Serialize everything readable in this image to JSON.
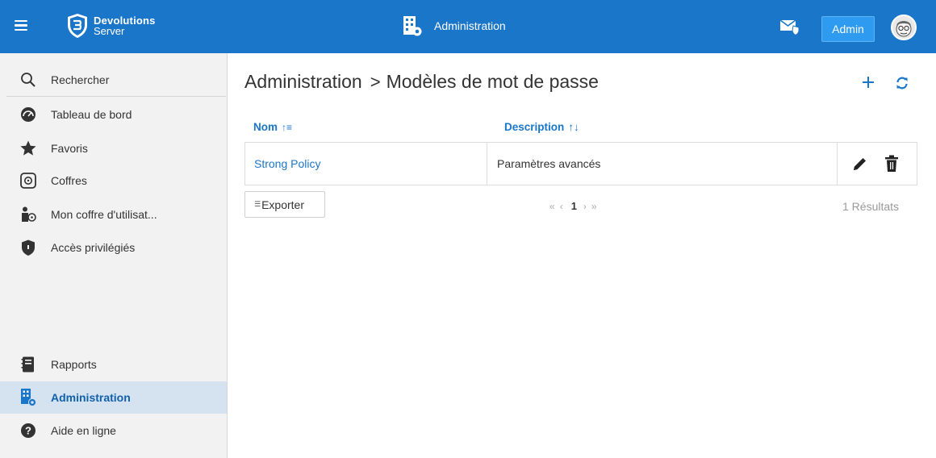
{
  "topbar": {
    "logo": {
      "line1": "Devolutions",
      "line2": "Server"
    },
    "section_title": "Administration",
    "admin_label": "Admin",
    "colors": {
      "bar": "#1a76c9",
      "admin_button": "#2f9bf0"
    }
  },
  "sidebar": {
    "top_items": [
      {
        "label": "Rechercher",
        "icon": "search-icon"
      },
      {
        "label": "Tableau de bord",
        "icon": "dashboard-icon"
      },
      {
        "label": "Favoris",
        "icon": "star-icon"
      },
      {
        "label": "Coffres",
        "icon": "vault-icon"
      },
      {
        "label": "Mon coffre d'utilisat...",
        "icon": "user-vault-icon"
      },
      {
        "label": "Accès privilégiés",
        "icon": "shield-icon"
      }
    ],
    "bottom_items": [
      {
        "label": "Rapports",
        "icon": "report-icon"
      },
      {
        "label": "Administration",
        "icon": "administration-icon",
        "active": true
      },
      {
        "label": "Aide en ligne",
        "icon": "help-icon"
      }
    ]
  },
  "main": {
    "breadcrumb": {
      "root": "Administration",
      "separator": ">",
      "current": "Modèles de mot de passe"
    },
    "columns": [
      {
        "label": "Nom",
        "sort_glyph": "↑≡"
      },
      {
        "label": "Description",
        "sort_glyph": "↑↓"
      }
    ],
    "rows": [
      {
        "name": "Strong Policy",
        "description": "Paramètres avancés"
      }
    ],
    "export_label": "Exporter",
    "pager": {
      "first": "«",
      "prev": "‹",
      "current": "1",
      "next": "›",
      "last": "»"
    },
    "results_text": "1 Résultats"
  }
}
